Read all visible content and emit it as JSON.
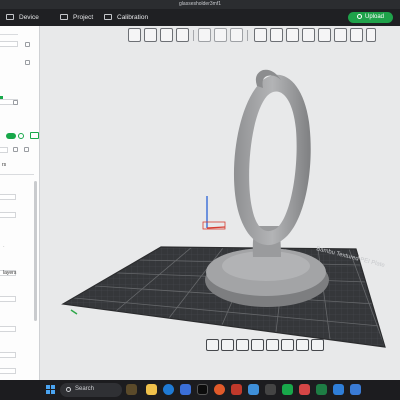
{
  "window": {
    "title": "glassesholder3mf1"
  },
  "menu": {
    "items": [
      {
        "label": "Device",
        "icon": "device-icon"
      },
      {
        "label": "Project",
        "icon": "project-icon"
      },
      {
        "label": "Calibration",
        "icon": "calibration-icon"
      }
    ],
    "upload_label": "Upload"
  },
  "left_panel": {
    "label_rs": "rs",
    "label_layers": "layers"
  },
  "viewport": {
    "bed_label": "Bambu Textured PEI Plate",
    "colors": {
      "background": "#e8e9ea",
      "bed": "#3a3b3d",
      "grid": "#505255",
      "model": "#9b9c9e",
      "axis_z": "#2a62d6",
      "axis_x": "#d63b30",
      "axis_y": "#2fa84a"
    }
  },
  "taskbar": {
    "search_placeholder": "Search",
    "apps": [
      "file-explorer-icon",
      "edge-icon",
      "store-icon",
      "bambu-studio-icon",
      "chrome-icon",
      "mail-icon",
      "excel-icon",
      "photos-icon"
    ]
  },
  "accent": "#1fa24a"
}
